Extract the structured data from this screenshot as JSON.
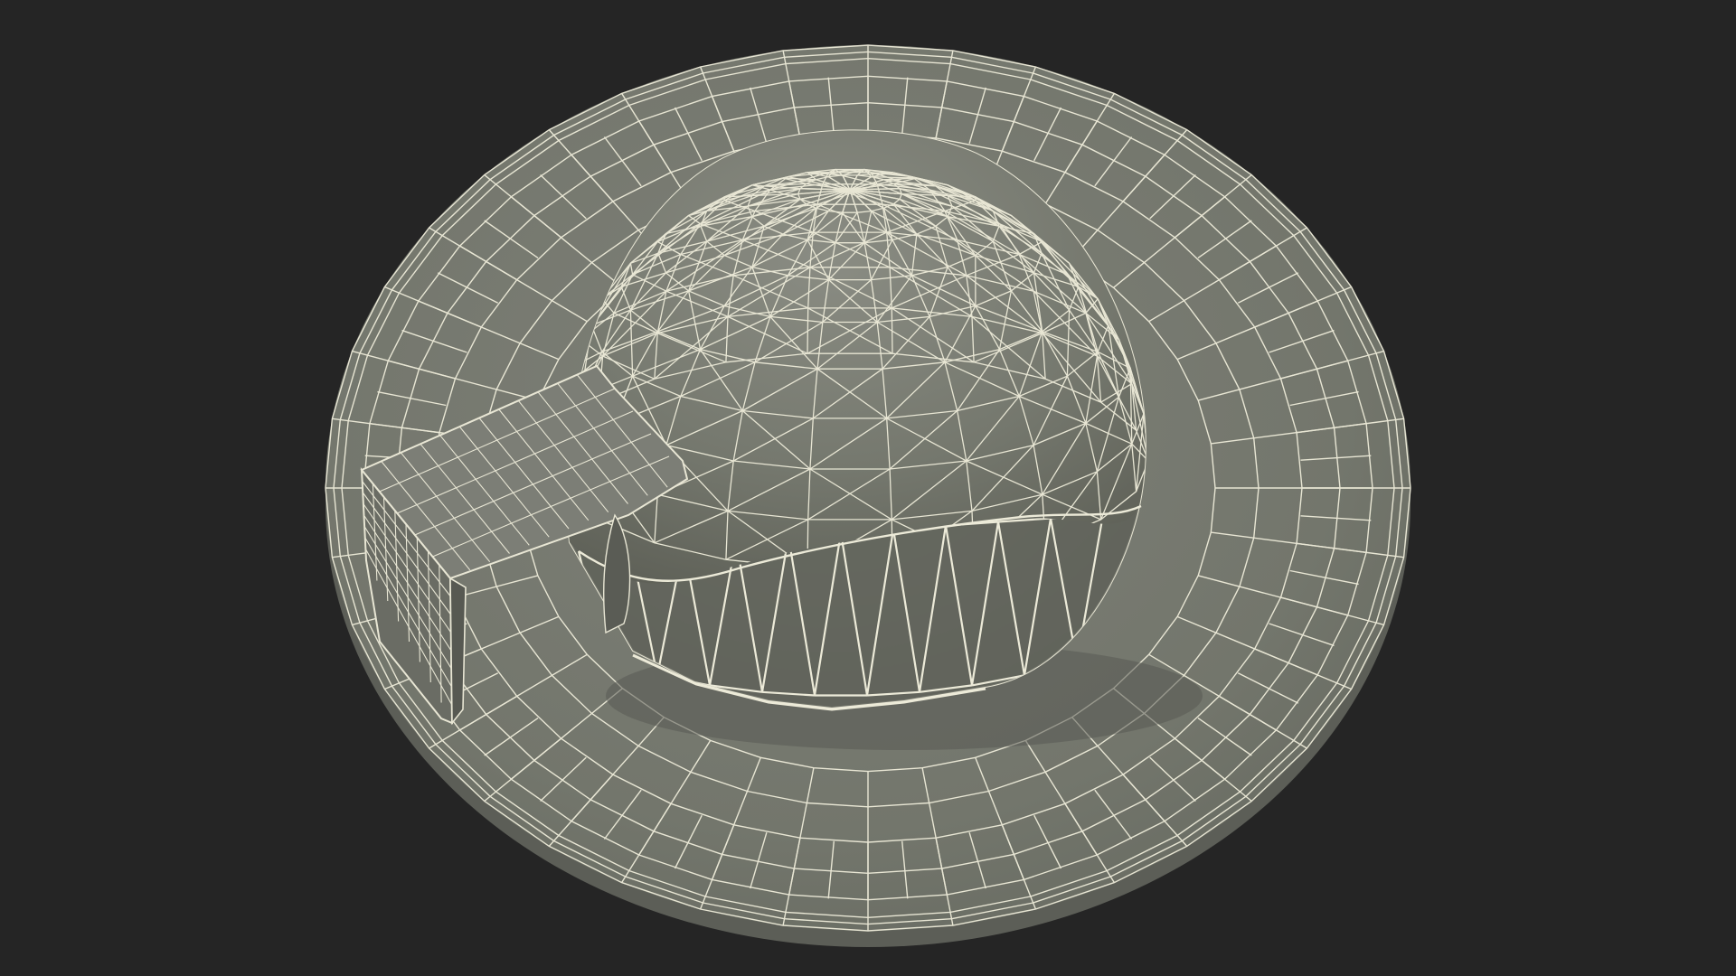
{
  "scene": {
    "subject": "igloo",
    "render_style": "wireframe-over-shaded",
    "colors": {
      "background": "#252525",
      "surface_light": "#80827a",
      "surface_mid": "#70736a",
      "surface_dark": "#5f6159",
      "wire": "#e8e6d4"
    }
  }
}
